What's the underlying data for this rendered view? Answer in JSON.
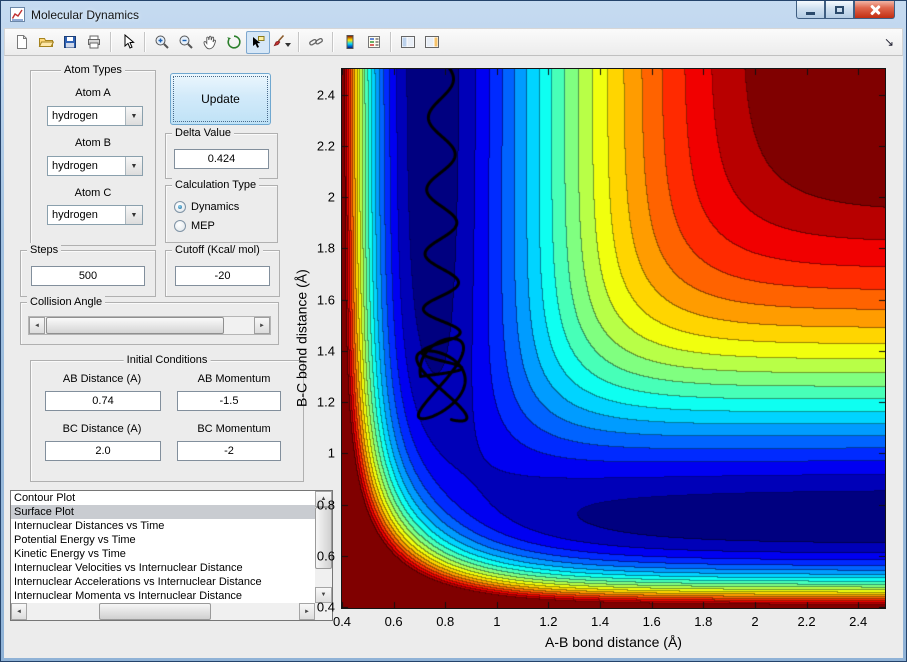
{
  "window": {
    "title": "Molecular Dynamics",
    "control_icons": [
      "minimize",
      "maximize",
      "close"
    ]
  },
  "toolbar": {
    "active_tool": "data-cursor",
    "icons": [
      "new-figure",
      "open-file",
      "save-figure",
      "print-figure",
      "edit-plot",
      "zoom-in",
      "zoom-out",
      "pan",
      "rotate-3d",
      "data-cursor",
      "brush",
      "link-plots",
      "insert-colorbar",
      "insert-legend",
      "hide-plot-tools",
      "show-plot-tools",
      "dock-figure"
    ]
  },
  "controls": {
    "atom_types": {
      "legend": "Atom Types",
      "fields": [
        {
          "label": "Atom A",
          "value": "hydrogen"
        },
        {
          "label": "Atom B",
          "value": "hydrogen"
        },
        {
          "label": "Atom C",
          "value": "hydrogen"
        }
      ]
    },
    "update_label": "Update",
    "delta": {
      "legend": "Delta Value",
      "value": "0.424"
    },
    "calculation_type": {
      "legend": "Calculation Type",
      "options": [
        {
          "label": "Dynamics",
          "selected": true
        },
        {
          "label": "MEP",
          "selected": false
        }
      ]
    },
    "steps": {
      "legend": "Steps",
      "value": "500"
    },
    "cutoff": {
      "legend": "Cutoff (Kcal/ mol)",
      "value": "-20"
    },
    "collision_angle": {
      "legend": "Collision Angle"
    },
    "initial_conditions": {
      "legend": "Initial Conditions",
      "fields": [
        {
          "label": "AB Distance (A)",
          "value": "0.74"
        },
        {
          "label": "AB Momentum",
          "value": "-1.5"
        },
        {
          "label": "BC Distance (A)",
          "value": "2.0"
        },
        {
          "label": "BC Momentum",
          "value": "-2"
        }
      ]
    },
    "plot_list": {
      "selected_index": 1,
      "items": [
        "Contour Plot",
        "Surface Plot",
        "Internuclear Distances vs Time",
        "Potential Energy vs Time",
        "Kinetic Energy vs Time",
        "Internuclear Velocities vs Internuclear Distance",
        "Internuclear Accelerations vs Internuclear Distance",
        "Internuclear Momenta vs Internuclear Distance"
      ]
    }
  },
  "chart_data": {
    "type": "contour",
    "title": "",
    "xlabel": "A-B bond distance (Å)",
    "ylabel": "B-C bond distance (Å)",
    "xlim": [
      0.4,
      2.5
    ],
    "ylim": [
      0.4,
      2.5
    ],
    "xticks": [
      0.4,
      0.6,
      0.8,
      1,
      1.2,
      1.4,
      1.6,
      1.8,
      2,
      2.2,
      2.4
    ],
    "yticks": [
      0.4,
      0.6,
      0.8,
      1,
      1.2,
      1.4,
      1.6,
      1.8,
      2,
      2.2,
      2.4
    ],
    "grid": false,
    "legend": "none",
    "colormap": "jet",
    "levels_kcal": {
      "min": -110,
      "max": -20,
      "step": 5
    },
    "potential": {
      "model": "LEPS collinear H + H2 potential energy surface",
      "D_kcal": 109.4,
      "beta_invA": 1.9413,
      "r0_A": 0.7419,
      "sato": 0.1425
    },
    "trajectory": {
      "color": "#000000",
      "line_width": 3,
      "center_x": 0.785,
      "amp_start": 0.045,
      "amp_end": 0.1,
      "cycles": 8.5,
      "phase0": -0.4,
      "y_top": 2.56,
      "y_knee": 1.3,
      "knee_t": 0.68,
      "loop_amp": 0.16,
      "loop_cycles": 1.8
    }
  }
}
